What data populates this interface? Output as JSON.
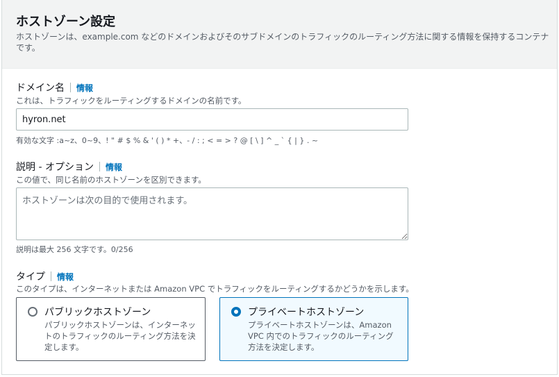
{
  "header": {
    "title": "ホストゾーン設定",
    "description": "ホストゾーンは、example.com などのドメインおよびそのサブドメインのトラフィックのルーティング方法に関する情報を保持するコンテナです。"
  },
  "domain": {
    "label": "ドメイン名",
    "info": "情報",
    "description": "これは、トラフィックをルーティングするドメインの名前です。",
    "value": "hyron.net",
    "hint": "有効な文字 :a~z、0~9、! \" # $ % & ' ( ) * +、- / : ; < = > ? @ [ \\ ] ^ _ ` { | } . ~"
  },
  "description_field": {
    "label": "説明 - オプション",
    "info": "情報",
    "description": "この値で、同じ名前のホストゾーンを区別できます。",
    "placeholder": "ホストゾーンは次の目的で使用されます。",
    "hint": "説明は最大 256 文字です。0/256"
  },
  "type": {
    "label": "タイプ",
    "info": "情報",
    "description": "このタイプは、インターネットまたは Amazon VPC でトラフィックをルーティングするかどうかを示します。",
    "options": [
      {
        "title": "パブリックホストゾーン",
        "description": "パブリックホストゾーンは、インターネットのトラフィックのルーティング方法を決定します。",
        "selected": false
      },
      {
        "title": "プライベートホストゾーン",
        "description": "プライベートホストゾーンは、Amazon VPC 内でのトラフィックのルーティング方法を決定します。",
        "selected": true
      }
    ]
  },
  "colors": {
    "accent": "#0073bb",
    "header_bg": "#f2f3f3",
    "selected_tile_bg": "#f1faff"
  }
}
